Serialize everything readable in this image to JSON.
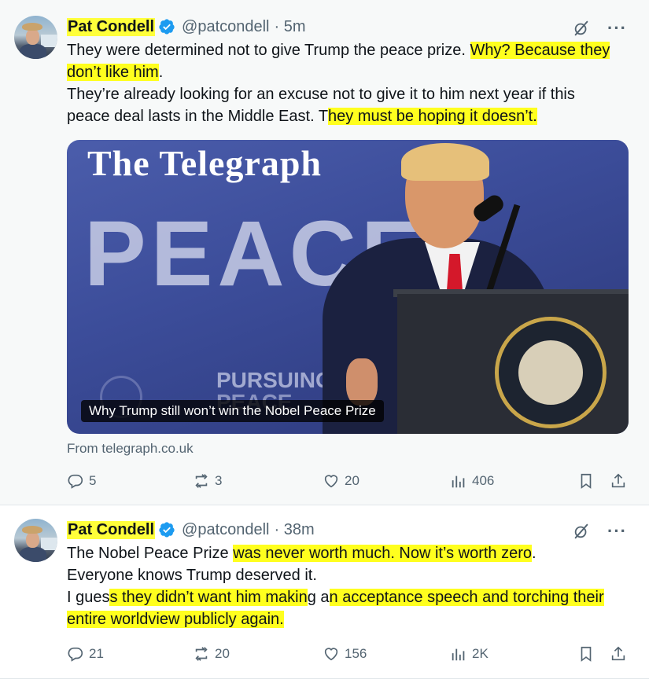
{
  "colors": {
    "highlight": "#ffff1e",
    "verified": "#1d9bf0",
    "muted_text": "#536471",
    "text": "#0f1419"
  },
  "tweets": [
    {
      "author_name": "Pat Condell",
      "handle": "@patcondell",
      "time": "· 5m",
      "paragraphs": [
        [
          {
            "text": "They were determined not to give Trump the peace prize. ",
            "hl": false
          },
          {
            "text": "Why? Because they don’t like him",
            "hl": true
          },
          {
            "text": ".",
            "hl": false
          }
        ],
        [
          {
            "text": "They’re already looking for an excuse not to give it to him next year if this peace deal lasts in the Middle East. T",
            "hl": false
          },
          {
            "text": "hey must be hoping it doesn’t.",
            "hl": true
          }
        ]
      ],
      "card": {
        "masthead": "The Telegraph",
        "backdrop_word": "PEACE",
        "backdrop_sub_1": "PURSUING",
        "backdrop_sub_2": "PEACE",
        "caption": "Why Trump still won’t win the Nobel Peace Prize"
      },
      "source": "From telegraph.co.uk",
      "stats": {
        "replies": "5",
        "reposts": "3",
        "likes": "20",
        "views": "406"
      }
    },
    {
      "author_name": "Pat Condell",
      "handle": "@patcondell",
      "time": "· 38m",
      "paragraphs": [
        [
          {
            "text": "The Nobel Peace Prize ",
            "hl": false
          },
          {
            "text": "was never worth much. Now it’s worth zero",
            "hl": true
          },
          {
            "text": ".",
            "hl": false
          }
        ],
        [
          {
            "text": "Everyone knows Trump deserved it.",
            "hl": false
          }
        ],
        [
          {
            "text": "I gues",
            "hl": false
          },
          {
            "text": "s they didn’t want him makin",
            "hl": true
          },
          {
            "text": "g a",
            "hl": false
          },
          {
            "text": "n acceptance speech and torching their entire worldview publicly again.",
            "hl": true
          }
        ]
      ],
      "stats": {
        "replies": "21",
        "reposts": "20",
        "likes": "156",
        "views": "2K"
      }
    }
  ]
}
